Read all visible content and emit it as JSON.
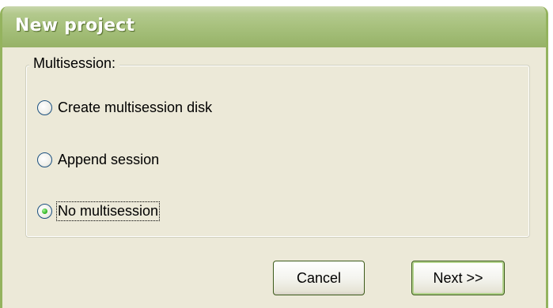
{
  "window": {
    "title": "New project"
  },
  "multisession": {
    "group_label": "Multisession:",
    "options": [
      {
        "label": "Create multisession disk",
        "selected": false
      },
      {
        "label": "Append session",
        "selected": false
      },
      {
        "label": "No multisession",
        "selected": true
      }
    ]
  },
  "buttons": {
    "cancel_label": "Cancel",
    "next_label": "Next >>"
  },
  "colors": {
    "titlebar": "#a9c27f",
    "window_bg": "#ece9d8",
    "radio_selected": "#3fbf32"
  }
}
